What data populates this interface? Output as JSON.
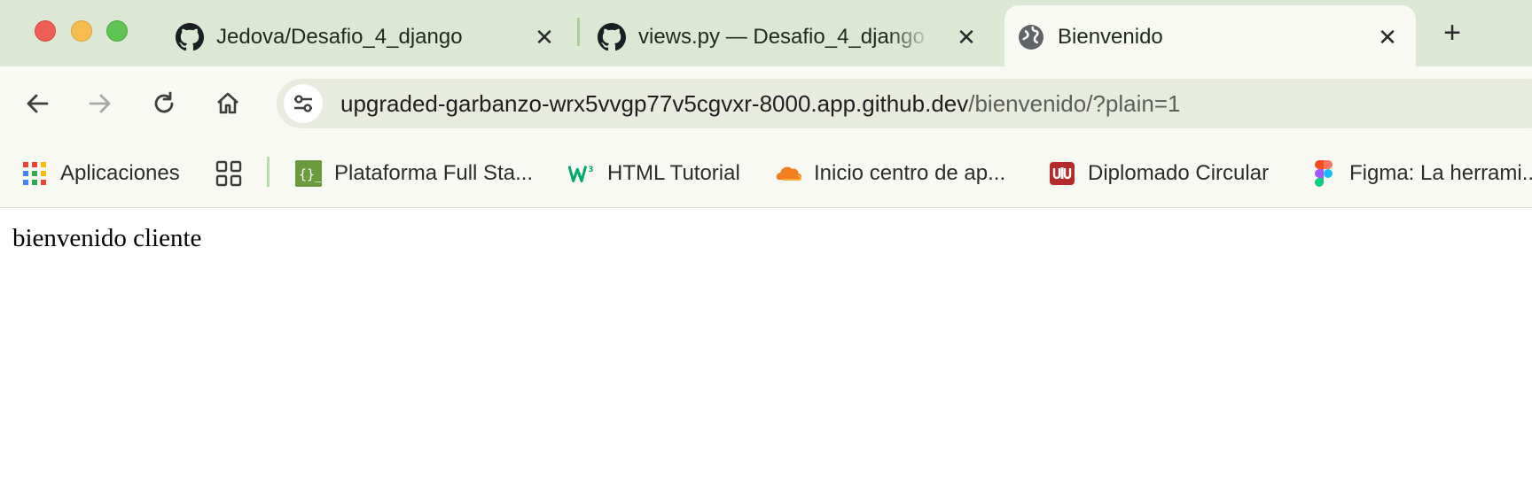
{
  "window": {
    "controls": [
      "close",
      "minimize",
      "zoom"
    ]
  },
  "tabs": [
    {
      "title": "Jedova/Desafio_4_django",
      "icon": "github-icon",
      "active": false
    },
    {
      "title": "views.py — Desafio_4_django",
      "icon": "github-icon",
      "active": false
    },
    {
      "title": "Bienvenido",
      "icon": "globe-icon",
      "active": true
    }
  ],
  "toolbar": {
    "url_host": "upgraded-garbanzo-wrx5vvgp77v5cgvxr-8000.app.github.dev",
    "url_path": "/bienvenido/?plain=1"
  },
  "bookmarks": [
    {
      "label": "Aplicaciones",
      "icon": "apps-grid-icon"
    },
    {
      "label": "",
      "icon": "tab-groups-icon"
    },
    {
      "label": "Plataforma Full Sta...",
      "icon": "code-braces-icon"
    },
    {
      "label": "HTML Tutorial",
      "icon": "w3schools-icon"
    },
    {
      "label": "Inicio centro de ap...",
      "icon": "cloud-icon"
    },
    {
      "label": "Diplomado Circular",
      "icon": "shield-logo-icon"
    },
    {
      "label": "Figma: La herrami...",
      "icon": "figma-icon"
    }
  ],
  "page": {
    "text": "bienvenido cliente"
  },
  "colors": {
    "tabstrip": "#dce8d4",
    "toolbar": "#f8f9f3",
    "omnibox": "#e8ecdf"
  }
}
